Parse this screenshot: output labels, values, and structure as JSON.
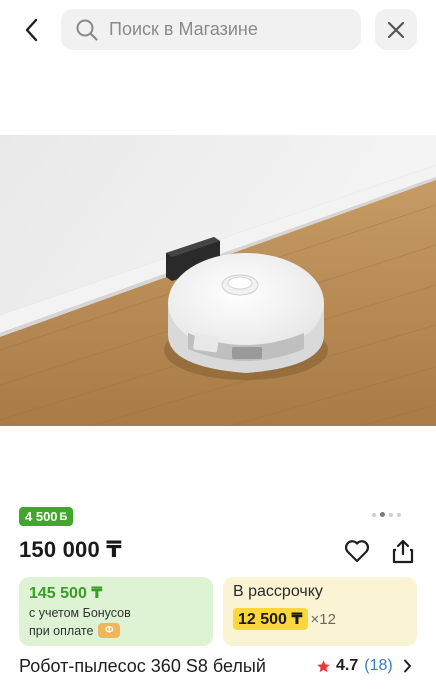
{
  "search": {
    "placeholder": "Поиск в Магазине"
  },
  "icons": {
    "back": "chevron-left-icon",
    "search": "search-icon",
    "close": "close-icon",
    "favorite": "heart-icon",
    "share": "share-icon",
    "rating_star": "star-icon",
    "rating_chevron": "chevron-right-icon",
    "bonus_coin": "bonus-coin-icon"
  },
  "gallery": {
    "total_images": 4,
    "active_index": 2
  },
  "product": {
    "bonus_badge": "4 500",
    "bonus_badge_unit": "Б",
    "price": "150 000 ₸",
    "title": "Робот-пылесос 360 S8 белый",
    "rating": "4.7",
    "reviews": "(18)"
  },
  "offers": {
    "bonus": {
      "amount": "145 500 ₸",
      "line1": "с учетом Бонусов",
      "line2": "при оплате"
    },
    "credit": {
      "label": "В рассрочку",
      "amount": "12 500 ₸",
      "multiplier": "×12"
    }
  },
  "colors": {
    "bonus_green": "#41a72b",
    "bonus_card_bg": "#ddf3d3",
    "credit_card_bg": "#fbf4d4",
    "credit_pill": "#fbd63d",
    "star_red": "#e83a3a",
    "link_blue": "#3c7bc6"
  }
}
